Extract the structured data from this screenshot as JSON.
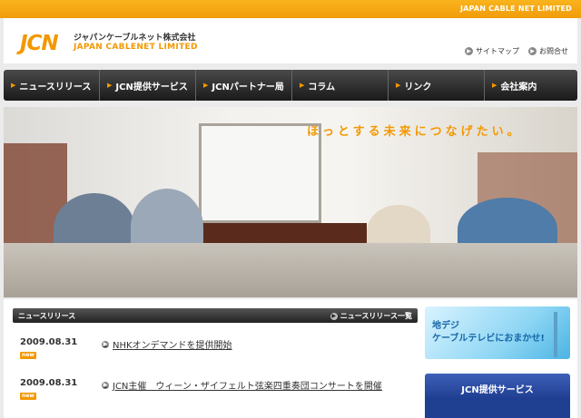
{
  "topbar": {
    "corp_name": "JAPAN CABLE NET LIMITED"
  },
  "header": {
    "logo_mark": "JCN",
    "logo_jp": "ジャパンケーブルネット株式会社",
    "logo_en": "JAPAN CABLENET LIMITED",
    "links": [
      {
        "label": "サイトマップ"
      },
      {
        "label": "お問合せ"
      }
    ]
  },
  "nav": {
    "items": [
      {
        "label": "ニュースリリース"
      },
      {
        "label": "JCN提供サービス"
      },
      {
        "label": "JCNパートナー局"
      },
      {
        "label": "コラム"
      },
      {
        "label": "リンク"
      },
      {
        "label": "会社案内"
      }
    ]
  },
  "hero": {
    "slogan": "ほっとする未来につなげたい。"
  },
  "news": {
    "section_title": "ニュースリリース",
    "more_label": "ニュースリリース一覧",
    "new_badge": "new",
    "items": [
      {
        "date": "2009.08.31",
        "title": "NHKオンデマンドを提供開始"
      },
      {
        "date": "2009.08.31",
        "title": "JCN主催　ウィーン・ザイフェルト弦楽四重奏団コンサートを開催"
      }
    ]
  },
  "sidebar": {
    "banner_line1": "地デジ",
    "banner_line2": "ケーブルテレビにおまかせ!",
    "services_title": "JCN提供サービス"
  },
  "colors": {
    "accent": "#f39800",
    "nav_dark": "#222222",
    "service_blue": "#1d3c8f"
  }
}
